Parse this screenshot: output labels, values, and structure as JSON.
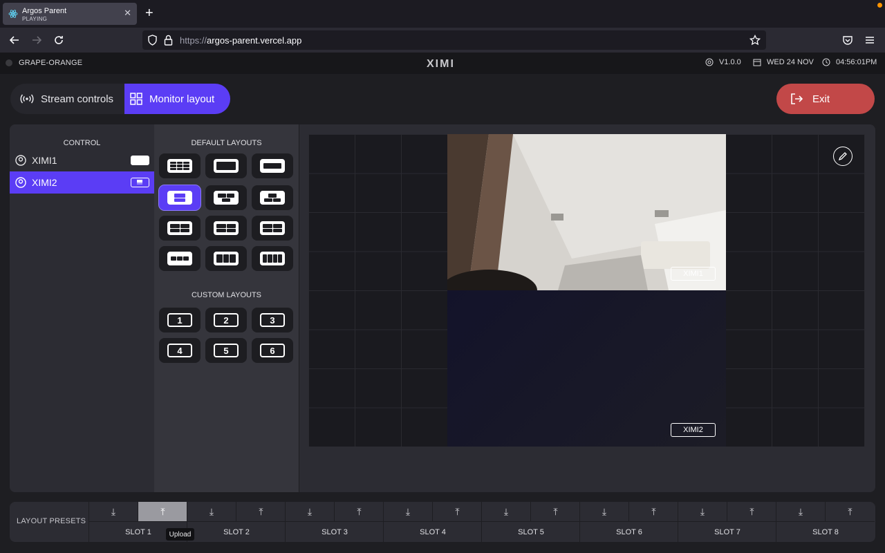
{
  "browser": {
    "tab_title": "Argos Parent",
    "tab_subtitle": "PLAYING",
    "url_scheme": "https://",
    "url_host": "argos-parent.vercel.app"
  },
  "appbar": {
    "device_name": "GRAPE-ORANGE",
    "logo": "XIMI",
    "version": "V1.0.0",
    "date": "WED 24 NOV",
    "time": "04:56:01PM"
  },
  "modes": {
    "stream": "Stream controls",
    "monitor": "Monitor layout",
    "exit": "Exit"
  },
  "control": {
    "header": "CONTROL",
    "items": [
      {
        "label": "XIMI1"
      },
      {
        "label": "XIMI2"
      }
    ]
  },
  "layouts": {
    "default_header": "DEFAULT LAYOUTS",
    "custom_header": "CUSTOM LAYOUTS",
    "custom": [
      "1",
      "2",
      "3",
      "4",
      "5",
      "6"
    ]
  },
  "preview": {
    "tags": [
      "XIMI1",
      "XIMI2"
    ]
  },
  "presets": {
    "label": "LAYOUT PRESETS",
    "slots": [
      "SLOT 1",
      "SLOT 2",
      "SLOT 3",
      "SLOT 4",
      "SLOT 5",
      "SLOT 6",
      "SLOT 7",
      "SLOT 8"
    ],
    "tooltip": "Upload"
  },
  "colors": {
    "accent": "#5b3df5",
    "exit": "#c24848"
  }
}
